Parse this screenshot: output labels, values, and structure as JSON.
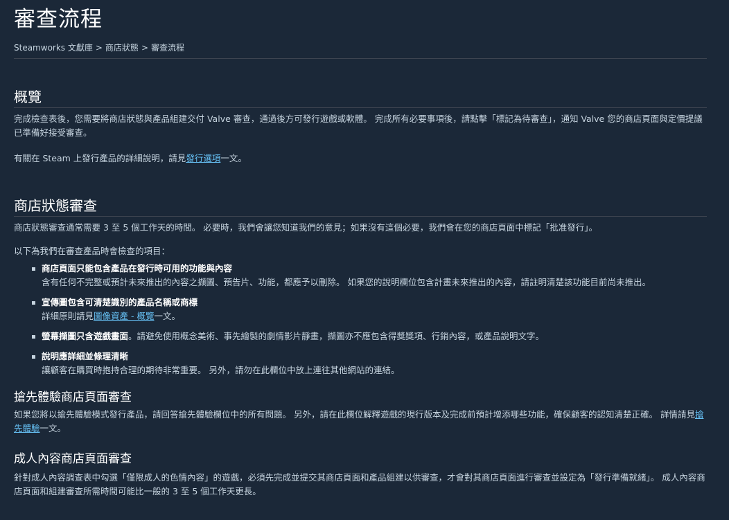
{
  "page": {
    "title": "審查流程",
    "breadcrumb": [
      "Steamworks 文獻庫",
      "商店狀態",
      "審查流程"
    ],
    "breadcrumb_sep": ">"
  },
  "overview": {
    "heading": "概覽",
    "para1": "完成檢查表後，您需要將商店狀態與產品組建交付 Valve 審查，通過後方可發行遊戲或軟體。 完成所有必要事項後，請點擊「標記為待審查」，通知 Valve 您的商店頁面與定價提議已準備好接受審查。",
    "para2_before": "有關在 Steam 上發行產品的詳細說明，請見",
    "para2_link": "發行選項",
    "para2_after": "一文。"
  },
  "store_review": {
    "heading": "商店狀態審查",
    "para1": "商店狀態審查通常需要 3 至 5 個工作天的時間。 必要時，我們會讓您知道我們的意見；如果沒有這個必要，我們會在您的商店頁面中標記「批准發行」。",
    "para2": "以下為我們在審查產品時會檢查的項目：",
    "items": [
      {
        "title": "商店頁面只能包含產品在發行時可用的功能與內容",
        "desc": "含有任何不完整或預計未來推出的內容之擷圖、預告片、功能，都應予以刪除。 如果您的說明欄位包含計畫未來推出的內容，請註明清楚該功能目前尚未推出。"
      },
      {
        "title": "宣傳圖包含可清楚識別的產品名稱或商標",
        "desc_before": "詳細原則請見",
        "desc_link": "圖像資產 - 概覽",
        "desc_after": "一文。"
      },
      {
        "title": "螢幕擷圖只含遊戲畫面",
        "inline": "。請避免使用概念美術、事先繪製的劇情影片靜畫，擷圖亦不應包含得獎獎項、行銷內容，或產品說明文字。"
      },
      {
        "title": "說明應詳細並條理清晰",
        "desc": "讓顧客在購買時抱持合理的期待非常重要。 另外，請勿在此欄位中放上連往其他網站的連結。"
      }
    ]
  },
  "early_access": {
    "heading": "搶先體驗商店頁面審查",
    "para_before": "如果您將以搶先體驗模式發行產品，請回答搶先體驗欄位中的所有問題。 另外，請在此欄位解釋遊戲的現行版本及完成前預計增添哪些功能，確保顧客的認知清楚正確。 詳情請見",
    "para_link": "搶先體驗",
    "para_after": "一文。"
  },
  "adult": {
    "heading": "成人內容商店頁面審查",
    "para": "針對成人內容調查表中勾選「僅限成人的色情內容」的遊戲，必須先完成並提交其商店頁面和產品組建以供審查，才會對其商店頁面進行審查並設定為「發行準備就緒」。 成人內容商店頁面和組建審查所需時間可能比一般的 3 至 5 個工作天更長。"
  }
}
